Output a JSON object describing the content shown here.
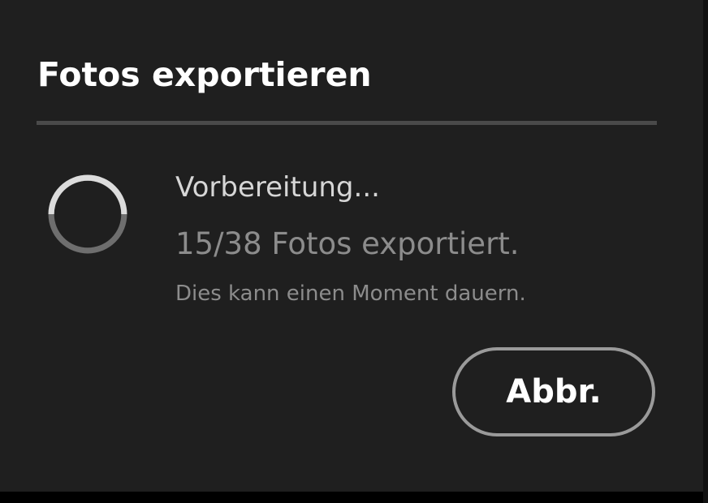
{
  "dialog": {
    "title": "Fotos exportieren",
    "status_title": "Vorbereitung...",
    "progress_text": "15/38 Fotos exportiert.",
    "note": "Dies kann einen Moment dauern.",
    "cancel_label": "Abbr.",
    "spinner_icon": "loading-spinner-icon",
    "colors": {
      "background": "#1f1f1f",
      "title": "#ffffff",
      "secondary_text": "#8c8c8c",
      "divider": "#4a4a4a",
      "button_border": "#9a9a9a"
    }
  }
}
